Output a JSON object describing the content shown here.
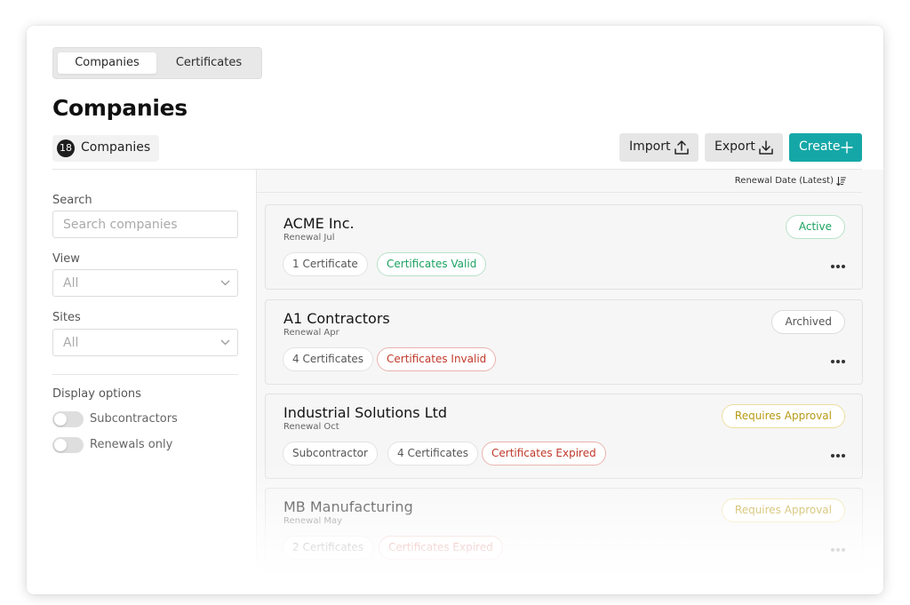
{
  "tabs": [
    {
      "label": "Companies"
    },
    {
      "label": "Certificates"
    }
  ],
  "page_title": "Companies",
  "count": {
    "number": "18",
    "label": "Companies"
  },
  "toolbar": {
    "import_label": "Import",
    "export_label": "Export",
    "create_label": "Create"
  },
  "sidebar": {
    "search_label": "Search",
    "search_placeholder": "Search companies",
    "view_label": "View",
    "view_value": "All",
    "sites_label": "Sites",
    "sites_value": "All",
    "display_options_label": "Display options",
    "toggles": [
      {
        "label": "Subcontractors"
      },
      {
        "label": "Renewals only"
      }
    ]
  },
  "sort": {
    "label": "Renewal Date (Latest)"
  },
  "companies": [
    {
      "name": "ACME Inc.",
      "renewal": "Renewal Jul",
      "status": "Active",
      "tags": [
        "1 Certificate",
        "Certificates Valid"
      ]
    },
    {
      "name": "A1 Contractors",
      "renewal": "Renewal Apr",
      "status": "Archived",
      "tags": [
        "4 Certificates",
        "Certificates Invalid"
      ]
    },
    {
      "name": "Industrial Solutions Ltd",
      "renewal": "Renewal Oct",
      "status": "Requires Approval",
      "tags": [
        "Subcontractor",
        "4 Certificates",
        "Certificates Expired"
      ]
    },
    {
      "name": "MB Manufacturing",
      "renewal": "Renewal May",
      "status": "Requires Approval",
      "tags": [
        "2 Certificates",
        "Certificates Expired"
      ]
    }
  ],
  "colors": {
    "accent": "#15a7a7",
    "valid": "#1aa260",
    "invalid": "#c0392b",
    "approval": "#b79a14"
  },
  "icons": {
    "import": "upload-icon",
    "export": "download-icon",
    "create": "plus-icon",
    "sort": "sort-descending-icon",
    "dropdown": "chevron-down-icon",
    "more": "more-horizontal-icon"
  }
}
